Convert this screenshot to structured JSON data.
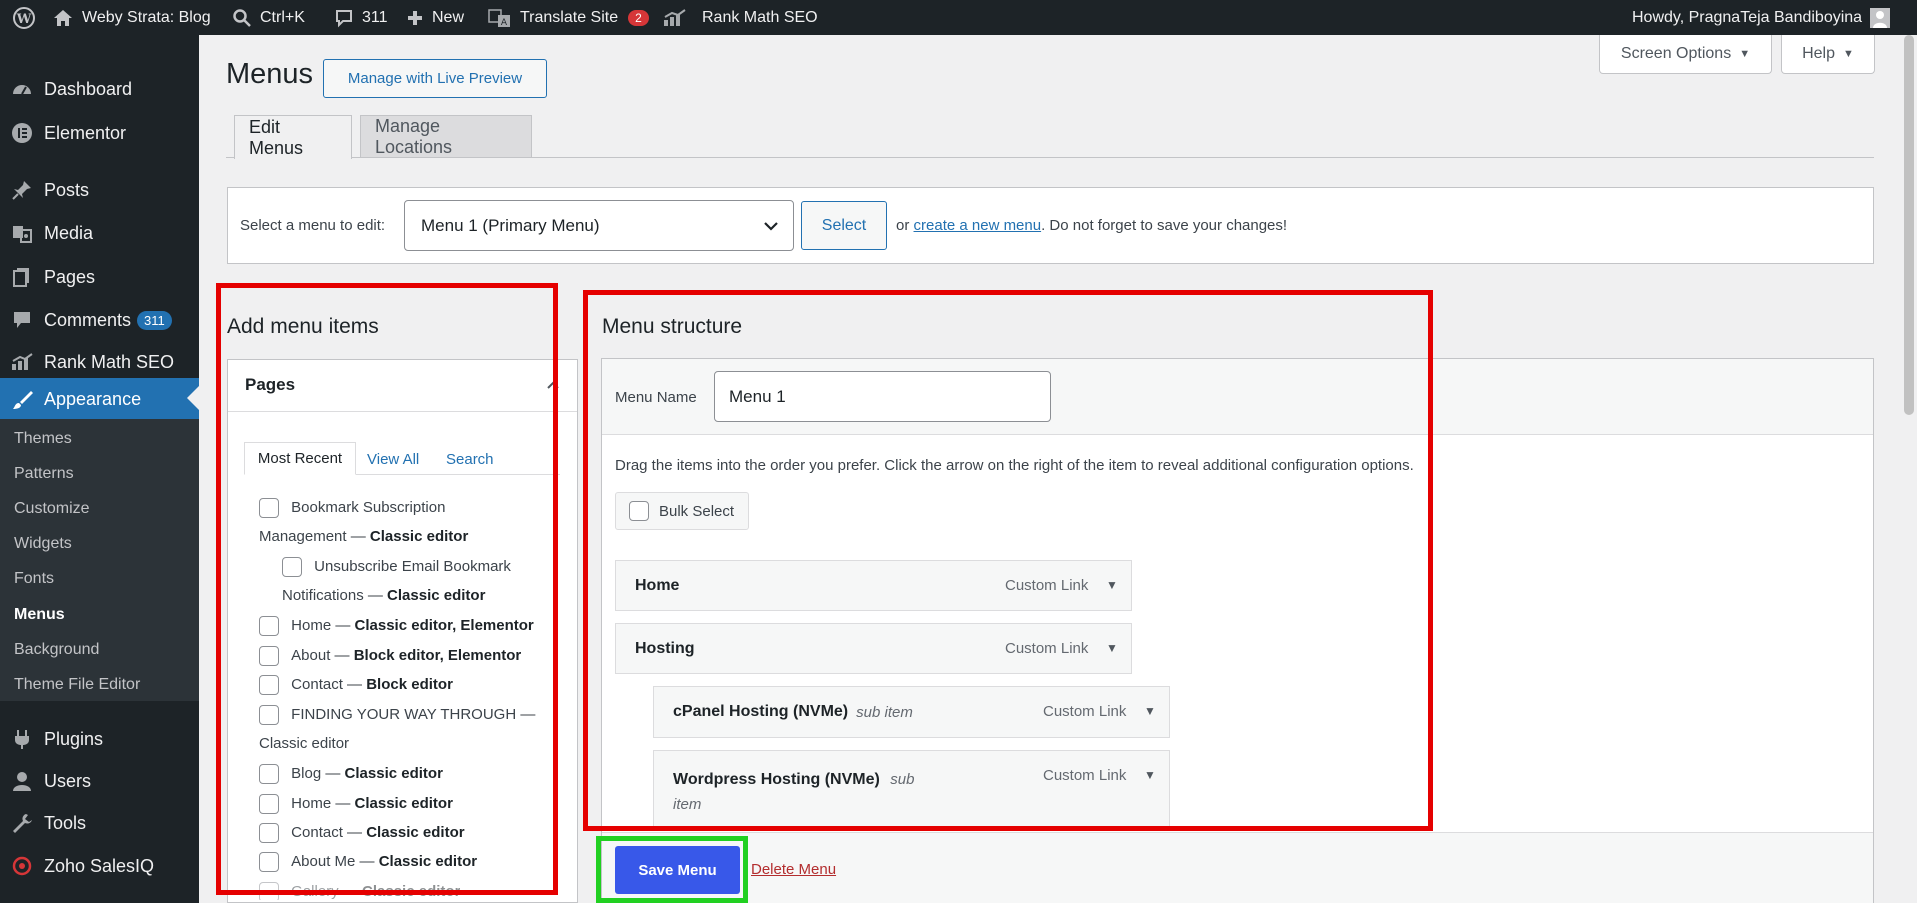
{
  "adminbar": {
    "site_name": "Weby Strata: Blog",
    "search_shortcut": "Ctrl+K",
    "comments_count": "311",
    "new_label": "New",
    "translate_label": "Translate Site",
    "translate_badge": "2",
    "rankmath_label": "Rank Math SEO",
    "howdy": "Howdy, PragnaTeja Bandiboyina"
  },
  "sidebar": {
    "items": [
      {
        "label": "Dashboard",
        "icon": "dashboard-icon"
      },
      {
        "label": "Elementor",
        "icon": "elementor-icon"
      },
      {
        "label": "Posts",
        "icon": "pin-icon"
      },
      {
        "label": "Media",
        "icon": "media-icon"
      },
      {
        "label": "Pages",
        "icon": "pages-icon"
      },
      {
        "label": "Comments",
        "icon": "comments-icon",
        "badge": "311"
      },
      {
        "label": "Rank Math SEO",
        "icon": "rankmath-icon"
      },
      {
        "label": "Appearance",
        "icon": "brush-icon"
      },
      {
        "label": "Plugins",
        "icon": "plugin-icon"
      },
      {
        "label": "Users",
        "icon": "users-icon"
      },
      {
        "label": "Tools",
        "icon": "tools-icon"
      },
      {
        "label": "Zoho SalesIQ",
        "icon": "zoho-icon"
      }
    ],
    "appearance_sub": [
      "Themes",
      "Patterns",
      "Customize",
      "Widgets",
      "Fonts",
      "Menus",
      "Background",
      "Theme File Editor"
    ]
  },
  "screen_options": "Screen Options",
  "help": "Help",
  "page_title": "Menus",
  "live_preview": "Manage with Live Preview",
  "tabs": {
    "edit": "Edit Menus",
    "locations": "Manage Locations"
  },
  "select_bar": {
    "label": "Select a menu to edit:",
    "selected": "Menu 1 (Primary Menu)",
    "select_btn": "Select",
    "or": "or",
    "create_link": "create a new menu",
    "reminder": ". Do not forget to save your changes!"
  },
  "add_items": {
    "heading": "Add menu items",
    "pages_title": "Pages",
    "tabs": [
      "Most Recent",
      "View All",
      "Search"
    ],
    "pages": [
      {
        "title": "Bookmark Subscription",
        "cont": "Management —",
        "bold": "Classic editor"
      },
      {
        "title": "Unsubscribe Email Bookmark",
        "cont": "Notifications —",
        "bold": "Classic editor"
      },
      {
        "title": "Home —",
        "bold": "Classic editor, Elementor"
      },
      {
        "title": "About —",
        "bold": "Block editor, Elementor"
      },
      {
        "title": "Contact —",
        "bold": "Block editor"
      },
      {
        "title": "FINDING YOUR WAY THROUGH —",
        "cont": "",
        "bold": "Classic editor"
      },
      {
        "title": "Blog —",
        "bold": "Classic editor"
      },
      {
        "title": "Home —",
        "bold": "Classic editor"
      },
      {
        "title": "Contact —",
        "bold": "Classic editor"
      },
      {
        "title": "About Me —",
        "bold": "Classic editor"
      },
      {
        "title": "Gallery —",
        "bold": "Classic editor"
      }
    ]
  },
  "structure": {
    "heading": "Menu structure",
    "name_label": "Menu Name",
    "name_value": "Menu 1",
    "instructions": "Drag the items into the order you prefer. Click the arrow on the right of the item to reveal additional configuration options.",
    "bulk_select": "Bulk Select",
    "items": [
      {
        "title": "Home",
        "type": "Custom Link"
      },
      {
        "title": "Hosting",
        "type": "Custom Link"
      },
      {
        "title": "cPanel Hosting (NVMe)",
        "sub": "sub item",
        "type": "Custom Link"
      },
      {
        "title": "Wordpress Hosting (NVMe)",
        "sub": "sub",
        "sub2": "item",
        "type": "Custom Link"
      }
    ]
  },
  "footer": {
    "save": "Save Menu",
    "delete": "Delete Menu"
  },
  "colors": {
    "accent": "#2271b1",
    "save": "#3858e9",
    "highlight_red": "#e50000",
    "highlight_green": "#21d021"
  }
}
